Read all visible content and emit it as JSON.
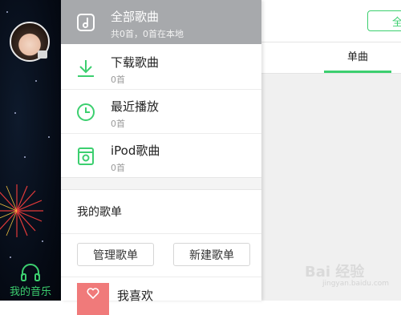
{
  "sidebar": {
    "tab_label": "我的音乐",
    "accent": "#3ccf6f"
  },
  "menu": {
    "items": [
      {
        "title": "全部歌曲",
        "subtitle": "共0首，0首在本地",
        "icon": "music-file-icon",
        "active": true
      },
      {
        "title": "下载歌曲",
        "subtitle": "0首",
        "icon": "download-icon",
        "active": false
      },
      {
        "title": "最近播放",
        "subtitle": "0首",
        "icon": "clock-icon",
        "active": false
      },
      {
        "title": "iPod歌曲",
        "subtitle": "0首",
        "icon": "ipod-icon",
        "active": false
      }
    ]
  },
  "playlists": {
    "header": "我的歌单",
    "manage_label": "管理歌单",
    "create_label": "新建歌单",
    "favorite_label": "我喜欢"
  },
  "right": {
    "button_label": "全",
    "tab_label": "单曲"
  },
  "watermark": {
    "text": "Bai 经验",
    "sub": "jingyan.baidu.com"
  }
}
